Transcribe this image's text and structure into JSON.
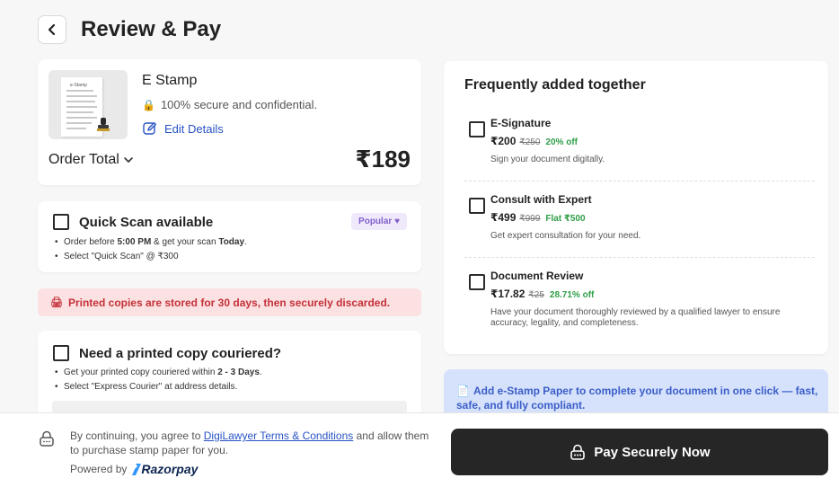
{
  "header": {
    "title": "Review & Pay"
  },
  "order": {
    "product_name": "E Stamp",
    "doc_label": "e-Stamp",
    "secure_text": "100% secure and confidential.",
    "edit_label": "Edit Details",
    "total_label": "Order Total",
    "total_price": "₹189"
  },
  "quick_scan": {
    "title": "Quick Scan available",
    "badge": "Popular",
    "bullet1_pre": "Order before ",
    "bullet1_time": "5:00 PM",
    "bullet1_mid": " & get your scan ",
    "bullet1_day": "Today",
    "bullet1_end": ".",
    "bullet2": "Select \"Quick Scan\" @ ₹300"
  },
  "notice": {
    "text": "Printed copies are stored for 30 days, then securely discarded."
  },
  "courier": {
    "title": "Need a printed copy couriered?",
    "bullet1_pre": "Get your printed copy couriered within ",
    "bullet1_days": "2 - 3 Days",
    "bullet1_end": ".",
    "bullet2": "Select \"Express Courier\" at address details."
  },
  "frequently": {
    "title": "Frequently added together",
    "items": [
      {
        "name": "E-Signature",
        "price": "₹200",
        "original": "₹250",
        "discount": "20% off",
        "desc": "Sign your document digitally."
      },
      {
        "name": "Consult with Expert",
        "price": "₹499",
        "original": "₹999",
        "discount": "Flat ₹500",
        "desc": "Get expert consultation for your need."
      },
      {
        "name": "Document Review",
        "price": "₹17.82",
        "original": "₹25",
        "discount": "28.71% off",
        "desc": "Have your document thoroughly reviewed by a qualified lawyer to ensure accuracy, legality, and completeness."
      }
    ]
  },
  "promo": {
    "text": "Add e-Stamp Paper to complete your document in one click — fast, safe, and fully compliant."
  },
  "footer": {
    "terms_pre": "By continuing, you agree to ",
    "terms_link": "DigiLawyer Terms & Conditions",
    "terms_post": " and allow them to purchase stamp paper for you.",
    "powered_by": "Powered by",
    "razorpay": "Razorpay",
    "pay_label": "Pay Securely Now"
  },
  "colors": {
    "accent_blue": "#2853c4",
    "discount_green": "#2f9e47",
    "notice_red": "#c5313a",
    "pay_button": "#262626"
  }
}
